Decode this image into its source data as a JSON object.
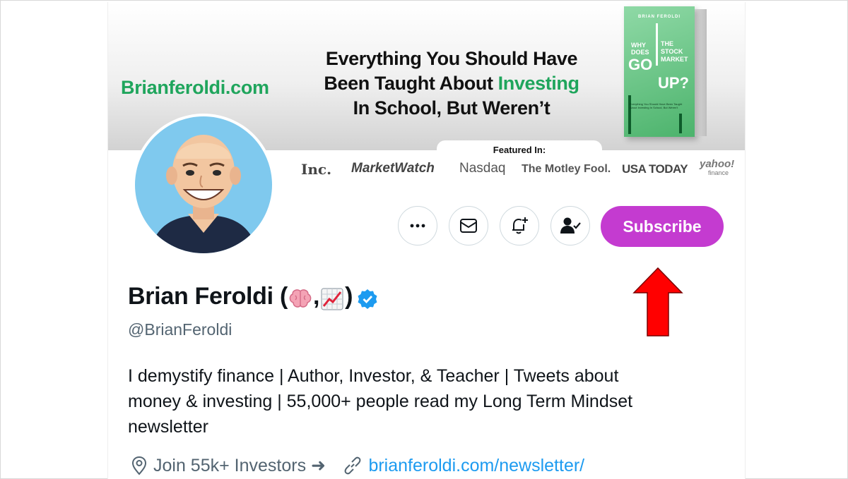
{
  "banner": {
    "site": "Brianferoldi.com",
    "headline_line1": "Everything You Should Have",
    "headline_line2_pre": "Been Taught About ",
    "headline_line2_em": "Investing",
    "headline_line3": "In School, But Weren’t",
    "book": {
      "author": "BRIAN FEROLDI",
      "title_why_does": "WHY DOES",
      "title_the_stock_market": "THE STOCK MARKET",
      "title_go": "GO",
      "title_up": "UP?",
      "subtitle": "Everything You Should Have Been Taught About Investing In School, But Weren't"
    },
    "featured_label": "Featured In:",
    "logos": {
      "inc": "Inc.",
      "marketwatch": "MarketWatch",
      "nasdaq": "Nasdaq",
      "motley": "The Motley Fool.",
      "usatoday": "USA TODAY",
      "yahoo": "yahoo!",
      "yahoo_sub": "finance"
    }
  },
  "actions": {
    "more_icon": "more-icon",
    "message_icon": "envelope-icon",
    "notify_icon": "bell-plus-icon",
    "follow_icon": "person-check-icon",
    "subscribe_label": "Subscribe",
    "subscribe_color": "#c43bd0"
  },
  "profile": {
    "name": "Brian Feroldi (",
    "name_comma": ",",
    "name_close": ")",
    "name_emojis": [
      "brain-emoji",
      "chart-increasing-emoji"
    ],
    "verified_icon": "verified-badge-icon",
    "handle": "@BrianFeroldi",
    "bio_line1": "I demystify finance | Author, Investor, & Teacher | Tweets about",
    "bio_line2": "money & investing | 55,000+ people read my Long Term Mindset",
    "bio_line3": "newsletter",
    "location_icon": "location-pin-icon",
    "location": "Join 55k+ Investors ➜",
    "link_icon": "link-icon",
    "website": "brianferoldi.com/newsletter/"
  },
  "annotation": {
    "arrow_icon": "red-arrow-up-icon",
    "arrow_color": "#ff0000"
  }
}
